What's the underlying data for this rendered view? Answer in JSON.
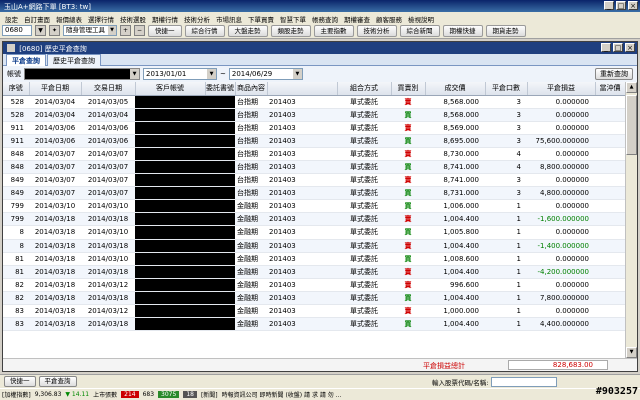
{
  "window": {
    "title": "玉山A+網路下單 [BT3: tw]"
  },
  "menu": [
    "設定",
    "自訂畫面",
    "報價總表",
    "選擇行情",
    "技術選股",
    "期權行情",
    "技術分析",
    "市場訊息",
    "下單買賣",
    "智慧下單",
    "帳務查詢",
    "期權審查",
    "顧客服務",
    "檢視說明"
  ],
  "toolbar": {
    "code": "0680",
    "selector": "隨身管理工具",
    "buttons": [
      "快捷一",
      "綜合行情",
      "大盤走勢",
      "類股走勢",
      "主要指數",
      "技術分析",
      "綜合新聞",
      "期權快捷",
      "期貨走勢"
    ]
  },
  "subwin": {
    "title": "[0680] 歷史平倉查詢"
  },
  "tabs": [
    "平倉查詢",
    "歷史平倉查詢"
  ],
  "filters": {
    "account_label": "帳號",
    "date_from": "2013/01/01",
    "date_sep": "~",
    "date_to": "2014/06/29",
    "refresh": "重新查詢"
  },
  "table": {
    "columns": [
      "序號",
      "平倉日期",
      "交易日期",
      "客戶帳號",
      "委託書號",
      "商品內容",
      "",
      "組合方式",
      "買賣別",
      "成交價",
      "平倉口數",
      "平倉損益",
      "當沖價"
    ],
    "rows": [
      {
        "seq": "528",
        "close": "2014/03/04",
        "trade": "2014/03/05",
        "prod": "台指期",
        "month": "201403",
        "combo": "單式委託",
        "side": "賣",
        "sidekind": "sell",
        "price": "8,568.000",
        "qty": "3",
        "pnl": "0.000000",
        "neg": false
      },
      {
        "seq": "528",
        "close": "2014/03/04",
        "trade": "2014/03/04",
        "prod": "台指期",
        "month": "201403",
        "combo": "單式委託",
        "side": "買",
        "sidekind": "buy",
        "price": "8,568.000",
        "qty": "3",
        "pnl": "0.000000",
        "neg": false
      },
      {
        "seq": "911",
        "close": "2014/03/06",
        "trade": "2014/03/06",
        "prod": "台指期",
        "month": "201403",
        "combo": "單式委託",
        "side": "賣",
        "sidekind": "sell",
        "price": "8,569.000",
        "qty": "3",
        "pnl": "0.000000",
        "neg": false
      },
      {
        "seq": "911",
        "close": "2014/03/06",
        "trade": "2014/03/06",
        "prod": "台指期",
        "month": "201403",
        "combo": "單式委託",
        "side": "買",
        "sidekind": "buy",
        "price": "8,695.000",
        "qty": "3",
        "pnl": "75,600.000000",
        "neg": false
      },
      {
        "seq": "848",
        "close": "2014/03/07",
        "trade": "2014/03/07",
        "prod": "台指期",
        "month": "201403",
        "combo": "單式委託",
        "side": "賣",
        "sidekind": "sell",
        "price": "8,730.000",
        "qty": "4",
        "pnl": "0.000000",
        "neg": false
      },
      {
        "seq": "848",
        "close": "2014/03/07",
        "trade": "2014/03/07",
        "prod": "台指期",
        "month": "201403",
        "combo": "單式委託",
        "side": "買",
        "sidekind": "buy",
        "price": "8,741.000",
        "qty": "4",
        "pnl": "8,800.000000",
        "neg": false
      },
      {
        "seq": "849",
        "close": "2014/03/07",
        "trade": "2014/03/07",
        "prod": "台指期",
        "month": "201403",
        "combo": "單式委託",
        "side": "賣",
        "sidekind": "sell",
        "price": "8,741.000",
        "qty": "3",
        "pnl": "0.000000",
        "neg": false
      },
      {
        "seq": "849",
        "close": "2014/03/07",
        "trade": "2014/03/07",
        "prod": "台指期",
        "month": "201403",
        "combo": "單式委託",
        "side": "買",
        "sidekind": "buy",
        "price": "8,731.000",
        "qty": "3",
        "pnl": "4,800.000000",
        "neg": false
      },
      {
        "seq": "799",
        "close": "2014/03/10",
        "trade": "2014/03/10",
        "prod": "金融期",
        "month": "201403",
        "combo": "單式委託",
        "side": "買",
        "sidekind": "buy",
        "price": "1,006.000",
        "qty": "1",
        "pnl": "0.000000",
        "neg": false
      },
      {
        "seq": "799",
        "close": "2014/03/18",
        "trade": "2014/03/18",
        "prod": "金融期",
        "month": "201403",
        "combo": "單式委託",
        "side": "賣",
        "sidekind": "sell",
        "price": "1,004.400",
        "qty": "1",
        "pnl": "-1,600.000000",
        "neg": true
      },
      {
        "seq": "8",
        "close": "2014/03/18",
        "trade": "2014/03/10",
        "prod": "金融期",
        "month": "201403",
        "combo": "單式委託",
        "side": "買",
        "sidekind": "buy",
        "price": "1,005.800",
        "qty": "1",
        "pnl": "0.000000",
        "neg": false
      },
      {
        "seq": "8",
        "close": "2014/03/18",
        "trade": "2014/03/18",
        "prod": "金融期",
        "month": "201403",
        "combo": "單式委託",
        "side": "賣",
        "sidekind": "sell",
        "price": "1,004.400",
        "qty": "1",
        "pnl": "-1,400.000000",
        "neg": true
      },
      {
        "seq": "81",
        "close": "2014/03/18",
        "trade": "2014/03/10",
        "prod": "金融期",
        "month": "201403",
        "combo": "單式委託",
        "side": "買",
        "sidekind": "buy",
        "price": "1,008.600",
        "qty": "1",
        "pnl": "0.000000",
        "neg": false
      },
      {
        "seq": "81",
        "close": "2014/03/18",
        "trade": "2014/03/18",
        "prod": "金融期",
        "month": "201403",
        "combo": "單式委託",
        "side": "賣",
        "sidekind": "sell",
        "price": "1,004.400",
        "qty": "1",
        "pnl": "-4,200.000000",
        "neg": true
      },
      {
        "seq": "82",
        "close": "2014/03/18",
        "trade": "2014/03/12",
        "prod": "金融期",
        "month": "201403",
        "combo": "單式委託",
        "side": "賣",
        "sidekind": "sell",
        "price": "996.600",
        "qty": "1",
        "pnl": "0.000000",
        "neg": false
      },
      {
        "seq": "82",
        "close": "2014/03/18",
        "trade": "2014/03/18",
        "prod": "金融期",
        "month": "201403",
        "combo": "單式委託",
        "side": "買",
        "sidekind": "buy",
        "price": "1,004.400",
        "qty": "1",
        "pnl": "7,800.000000",
        "neg": false
      },
      {
        "seq": "83",
        "close": "2014/03/18",
        "trade": "2014/03/12",
        "prod": "金融期",
        "month": "201403",
        "combo": "單式委託",
        "side": "賣",
        "sidekind": "sell",
        "price": "1,000.000",
        "qty": "1",
        "pnl": "0.000000",
        "neg": false
      },
      {
        "seq": "83",
        "close": "2014/03/18",
        "trade": "2014/03/18",
        "prod": "金融期",
        "month": "201403",
        "combo": "單式委託",
        "side": "買",
        "sidekind": "buy",
        "price": "1,004.400",
        "qty": "1",
        "pnl": "4,400.000000",
        "neg": false
      }
    ]
  },
  "totals": {
    "label": "平倉損益總計",
    "value": "828,683.00"
  },
  "taskbar": {
    "buttons": [
      "快捷一",
      "平倉查詢"
    ],
    "search_label": "輸入股票代碼/名稱:"
  },
  "status": {
    "index_name": "[加權指數]",
    "index_value": "9,306.83",
    "index_change": "▼ 14.11",
    "market_label": "上市張數",
    "up_count": "214",
    "unch_count": "683",
    "down_count": "3075",
    "limit_count": "18",
    "news_label": "[新聞]",
    "news_text": "時報資訊公司   即時新聞    (收盤)    請 求 請 勿 ..."
  },
  "watermark": "#903257",
  "colors": {
    "buy": "#008000",
    "sell": "#d00000",
    "negative_pnl": "#008000",
    "total": "#cc0000"
  }
}
